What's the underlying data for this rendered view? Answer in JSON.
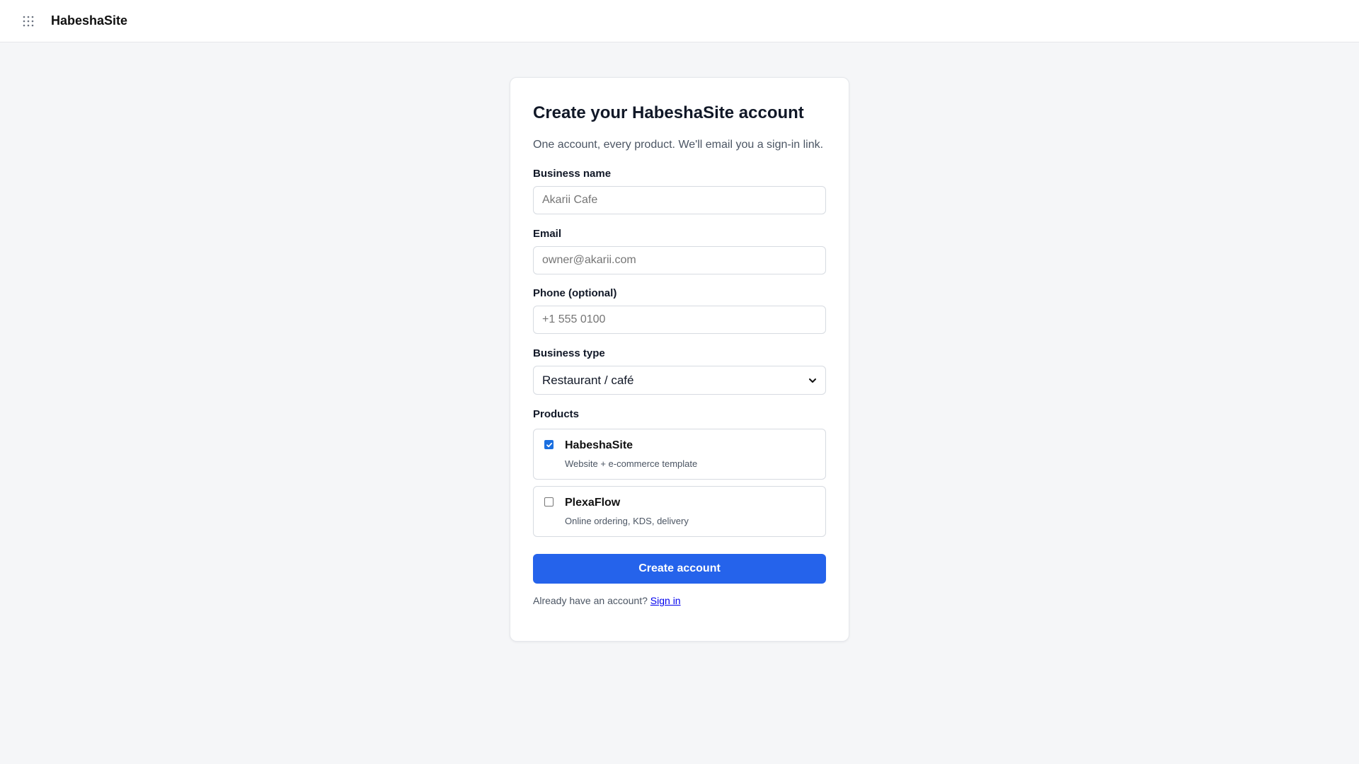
{
  "header": {
    "apps_icon": "grid-dots-icon",
    "brand": "HabeshaSite"
  },
  "form": {
    "title": "Create your HabeshaSite account",
    "subtitle": "One account, every product. We'll email you a sign-in link.",
    "business_name": {
      "label": "Business name",
      "placeholder": "Akarii Cafe",
      "value": ""
    },
    "email": {
      "label": "Email",
      "placeholder": "owner@akarii.com",
      "value": ""
    },
    "phone": {
      "label": "Phone (optional)",
      "placeholder": "+1 555 0100",
      "value": ""
    },
    "business_type": {
      "label": "Business type",
      "selected": "Restaurant / café"
    },
    "products_label": "Products",
    "products": [
      {
        "name": "HabeshaSite",
        "description": "Website + e-commerce template",
        "checked": true
      },
      {
        "name": "PlexaFlow",
        "description": "Online ordering, KDS, delivery",
        "checked": false
      }
    ],
    "submit_label": "Create account",
    "signin_prompt": "Already have an account?",
    "signin_link": "Sign in"
  },
  "colors": {
    "accent": "#2563eb",
    "checkbox": "#1a6fe0",
    "link": "#0000ee",
    "background": "#f5f6f8"
  }
}
